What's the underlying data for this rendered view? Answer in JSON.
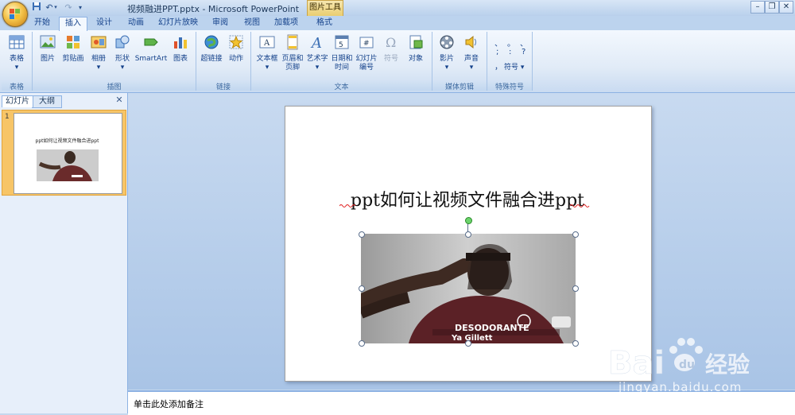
{
  "titlebar": {
    "title": "视频融进PPT.pptx - Microsoft PowerPoint",
    "context_tab": "图片工具",
    "quick_access": [
      "save-icon",
      "undo-icon",
      "redo-icon",
      "customize-icon"
    ]
  },
  "tabs": [
    "开始",
    "插入",
    "设计",
    "动画",
    "幻灯片放映",
    "审阅",
    "视图",
    "加载项",
    "格式"
  ],
  "active_tab": "插入",
  "ribbon": {
    "groups": {
      "table": "表格",
      "illustrations": "插图",
      "links": "链接",
      "text": "文本",
      "media": "媒体剪辑",
      "symbols": "特殊符号"
    },
    "buttons": {
      "table": "表格",
      "picture": "图片",
      "clipart": "剪贴画",
      "album": "相册",
      "shapes": "形状",
      "smartart": "SmartArt",
      "chart": "图表",
      "hyperlink": "超链接",
      "action": "动作",
      "textbox": "文本框",
      "header_footer_1": "页眉和",
      "header_footer_2": "页脚",
      "wordart": "艺术字",
      "datetime_1": "日期和",
      "datetime_2": "时间",
      "slide_number_1": "幻灯片",
      "slide_number_2": "编号",
      "symbol": "符号",
      "object": "对象",
      "movie": "影片",
      "sound": "声音",
      "special_symbol": "符号"
    },
    "symbol_glyphs": [
      "、",
      "。",
      "、",
      ";",
      ":",
      "?",
      "，"
    ]
  },
  "leftpane": {
    "tabs": [
      "幻灯片",
      "大纲"
    ],
    "slide_number": "1",
    "thumb_title": "ppt如何让视频文件融合进ppt"
  },
  "slide": {
    "title": "ppt如何让视频文件融合进ppt"
  },
  "notes": {
    "placeholder": "单击此处添加备注"
  },
  "watermark": {
    "text": "Bai经验",
    "url": "jingyan.baidu.com"
  }
}
